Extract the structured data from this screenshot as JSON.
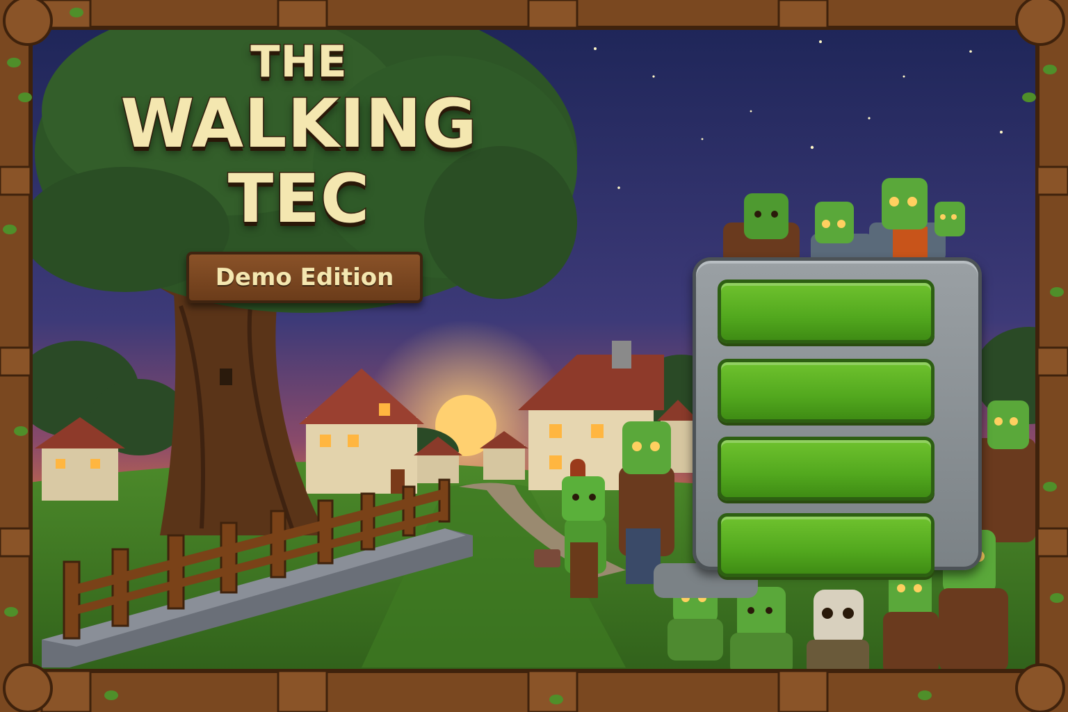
{
  "title": {
    "line1": "THE",
    "line2": "WALKING",
    "line3": "TEC"
  },
  "edition_label": "Demo Edition",
  "menu": {
    "buttons": [
      "",
      "",
      "",
      ""
    ]
  },
  "colors": {
    "title_text": "#f4e7b0",
    "button_green": "#52a81e",
    "panel_stone": "#8a9094",
    "frame_wood": "#7a4820",
    "zombie_skin": "#5aa03a"
  }
}
